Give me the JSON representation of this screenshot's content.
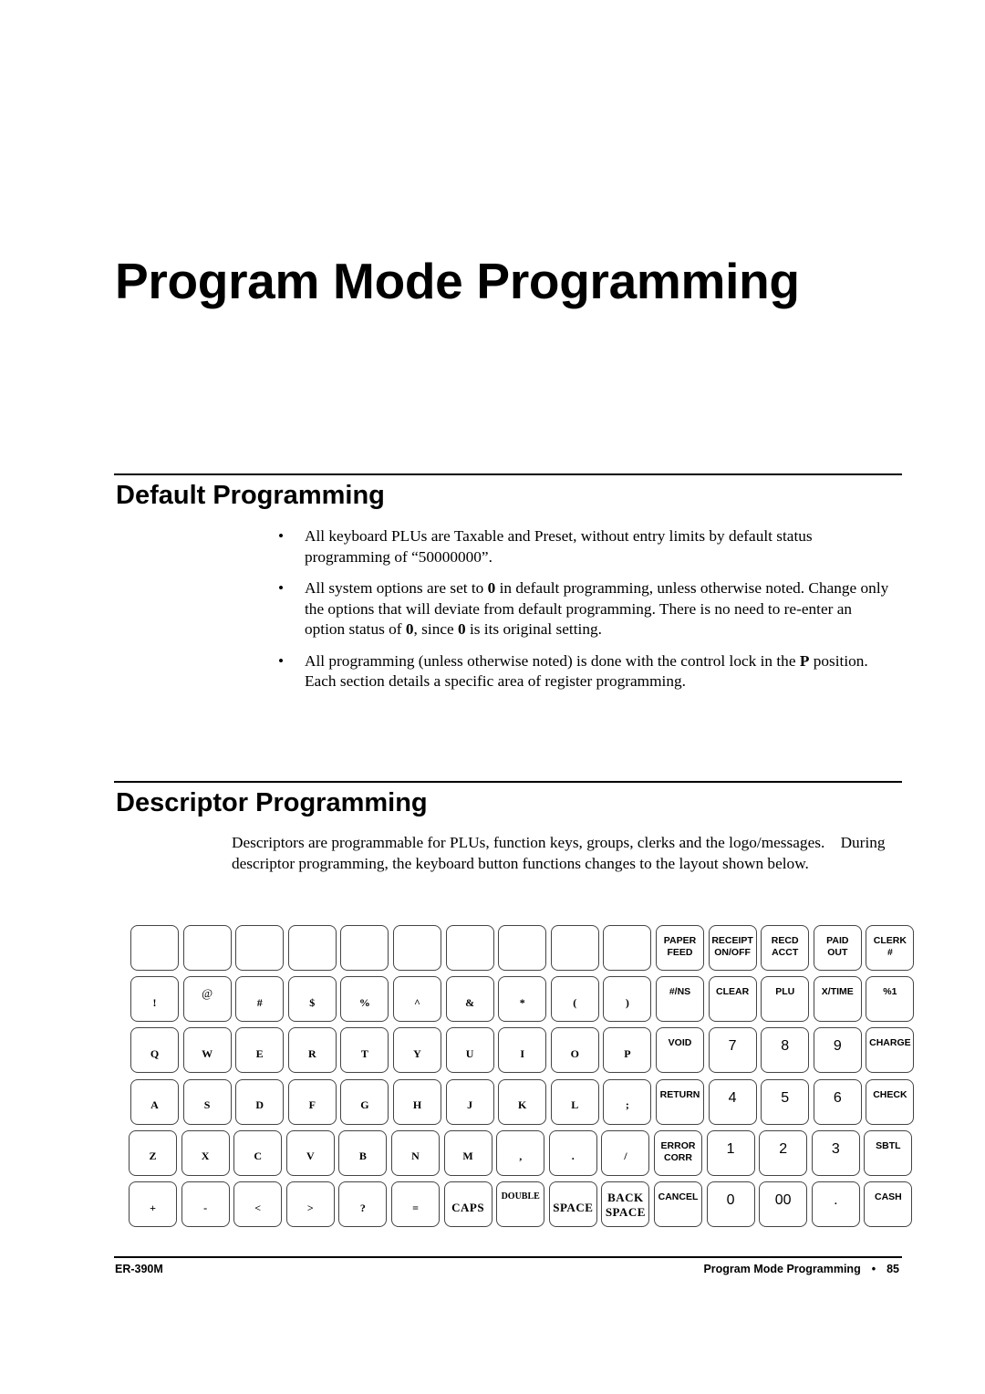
{
  "chapter_title": "Program Mode Programming",
  "sections": {
    "default": {
      "title": "Default Programming",
      "bullets": [
        "All keyboard PLUs are Taxable and Preset, without entry limits by default status programming of “50000000”.",
        "All system options are set to 0 in default programming, unless otherwise noted. Change only the options that will deviate from default programming. There is no need to re-enter an option status of 0, since 0 is its original setting.",
        "All programming (unless otherwise noted) is done with the control lock in the P position. Each section details a specific area of register programming."
      ],
      "bullet_html": [
        "All keyboard PLUs are Taxable and Preset, without entry limits by default status programming of “50000000”.",
        "All system options are set to <b>0</b> in default programming, unless otherwise noted. Change only the options that will deviate from default programming. There is no need to re-enter an option status of <b>0</b>, since <b>0</b> is its original setting.",
        "All programming (unless otherwise noted) is done with the control lock in the <b>P</b> position. Each section details a specific area of register programming."
      ],
      "bullet_symbol": "•"
    },
    "descriptor": {
      "title": "Descriptor Programming",
      "paragraph": "Descriptors are programmable for PLUs, function keys, groups, clerks and the logo/messages.    During descriptor programming, the keyboard button functions changes to the layout shown below."
    }
  },
  "keyboard": {
    "rows": [
      [
        "",
        "",
        "",
        "",
        "",
        "",
        "",
        "",
        "",
        "",
        "PAPER\nFEED",
        "RECEIPT\nON/OFF",
        "RECD\nACCT",
        "PAID\nOUT",
        "CLERK\n#"
      ],
      [
        "!",
        "@",
        "#",
        "$",
        "%",
        "^",
        "&",
        "*",
        "(",
        ")",
        "#/NS",
        "CLEAR",
        "PLU",
        "X/TIME",
        "%1"
      ],
      [
        "Q",
        "W",
        "E",
        "R",
        "T",
        "Y",
        "U",
        "I",
        "O",
        "P",
        "VOID",
        "7",
        "8",
        "9",
        "CHARGE"
      ],
      [
        "A",
        "S",
        "D",
        "F",
        "G",
        "H",
        "J",
        "K",
        "L",
        ";",
        "RETURN",
        "4",
        "5",
        "6",
        "CHECK"
      ],
      [
        "Z",
        "X",
        "C",
        "V",
        "B",
        "N",
        "M",
        ",",
        ".",
        "/",
        "ERROR\nCORR",
        "1",
        "2",
        "3",
        "SBTL"
      ],
      [
        "+",
        "-",
        "<",
        ">",
        "?",
        "=",
        "CAPS",
        "DOUBLE",
        "SPACE",
        "BACK\nSPACE",
        "CANCEL",
        "0",
        "00",
        ".",
        "CASH"
      ]
    ]
  },
  "footer": {
    "model": "ER-390M",
    "section": "Program Mode Programming",
    "separator": "•",
    "page_number": "85"
  }
}
